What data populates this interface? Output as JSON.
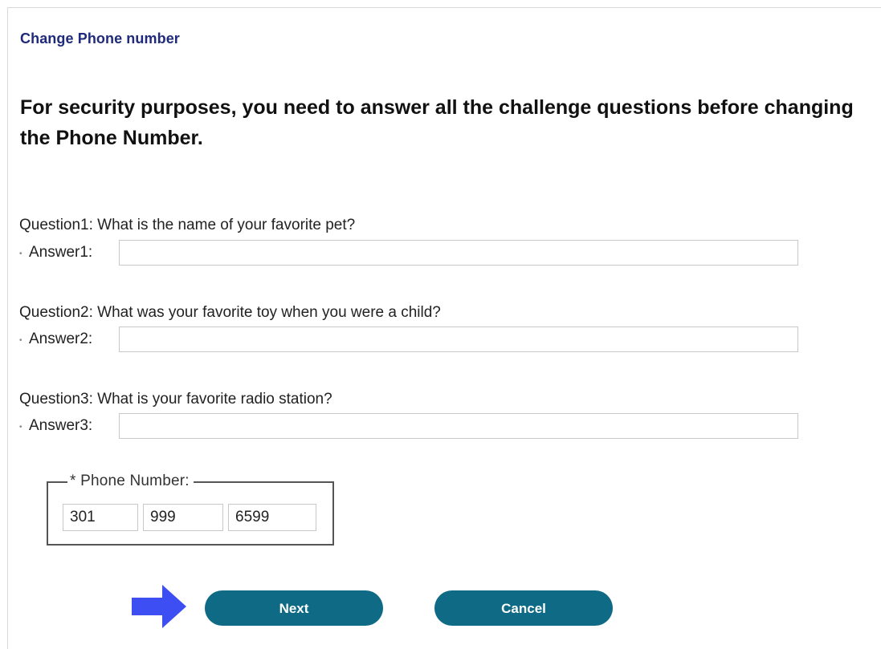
{
  "page": {
    "title": "Change Phone number",
    "heading": "For security purposes, you need to answer all the challenge questions before changing the Phone Number."
  },
  "questions": [
    {
      "question": "Question1: What is the name of your favorite pet?",
      "answer_label": "Answer1:",
      "answer_value": ""
    },
    {
      "question": "Question2: What was your favorite toy when you were a child?",
      "answer_label": "Answer2:",
      "answer_value": ""
    },
    {
      "question": "Question3: What is your favorite radio station?",
      "answer_label": "Answer3:",
      "answer_value": ""
    }
  ],
  "phone": {
    "legend": "* Phone Number:",
    "area_code": "301",
    "prefix": "999",
    "line": "6599"
  },
  "buttons": {
    "next": "Next",
    "cancel": "Cancel"
  },
  "colors": {
    "title": "#1f2a7a",
    "button": "#0f6b85",
    "arrow": "#3d4ff2"
  },
  "icons": {
    "pointer": "right-arrow-icon"
  }
}
